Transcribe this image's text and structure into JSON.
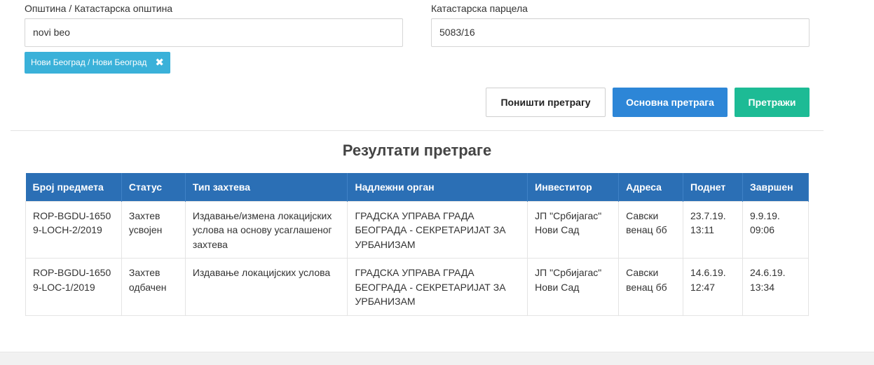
{
  "filters": {
    "municipality_label": "Општина / Катастарска општина",
    "municipality_value": "novi beo",
    "parcel_label": "Катастарска парцела",
    "parcel_value": "5083/16",
    "selected_tag": "Нови Београд / Нови Београд",
    "tag_remove_icon": "✖"
  },
  "buttons": {
    "reset": "Поништи претрагу",
    "basic": "Основна претрага",
    "search": "Претражи"
  },
  "results": {
    "title": "Резултати претраге",
    "columns": [
      "Број предмета",
      "Статус",
      "Тип захтева",
      "Надлежни орган",
      "Инвеститор",
      "Адреса",
      "Поднет",
      "Завршен"
    ],
    "rows": [
      {
        "case_number": "ROP-BGDU-16509-LOCH-2/2019",
        "status": "Захтев усвојен",
        "request_type": "Издавање/измена локацијских услова на основу усаглашеног захтева",
        "authority": "ГРАДСКА УПРАВА ГРАДА БЕОГРАДА - СЕКРЕТАРИЈАТ ЗА УРБАНИЗАМ",
        "investor": "ЈП \"Србијагас\" Нови Сад",
        "address": "Савски венац бб",
        "submitted": "23.7.19. 13:11",
        "completed": "9.9.19. 09:06"
      },
      {
        "case_number": "ROP-BGDU-16509-LOC-1/2019",
        "status": "Захтев одбачен",
        "request_type": "Издавање локацијских услова",
        "authority": "ГРАДСКА УПРАВА ГРАДА БЕОГРАДА - СЕКРЕТАРИЈАТ ЗА УРБАНИЗАМ",
        "investor": "ЈП \"Србијагас\" Нови Сад",
        "address": "Савски венац бб",
        "submitted": "14.6.19. 12:47",
        "completed": "24.6.19. 13:34"
      }
    ]
  },
  "colors": {
    "tag": "#3ab1d9",
    "basic_button": "#2d86d7",
    "search_button": "#1dbb95",
    "table_header": "#2b6fb5"
  }
}
